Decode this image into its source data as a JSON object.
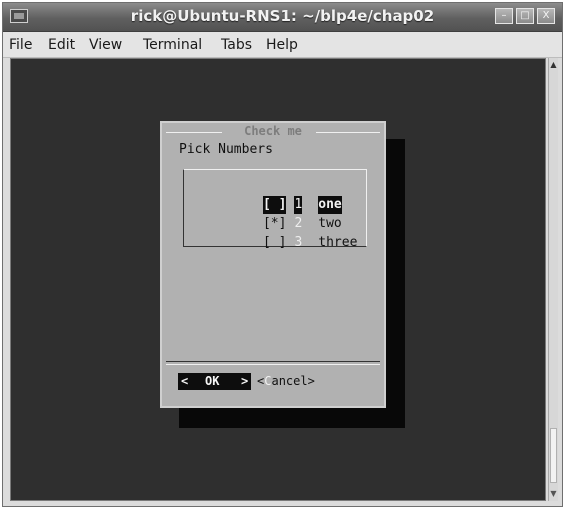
{
  "window": {
    "title": "rick@Ubuntu-RNS1: ~/blp4e/chap02",
    "controls": {
      "minimize": "–",
      "maximize": "□",
      "close": "X"
    }
  },
  "menubar": {
    "items": [
      "File",
      "Edit",
      "View",
      "Terminal",
      "Tabs",
      "Help"
    ]
  },
  "dialog": {
    "title": "Check me",
    "prompt": "Pick Numbers",
    "items": [
      {
        "mark": "[ ]",
        "number": "1",
        "label": "one",
        "checked": false,
        "highlighted": true
      },
      {
        "mark": "[*]",
        "number": "2",
        "label": "two",
        "checked": true,
        "highlighted": false
      },
      {
        "mark": "[ ]",
        "number": "3",
        "label": "three",
        "checked": false,
        "highlighted": false
      }
    ],
    "buttons": {
      "ok": {
        "left": "<",
        "label": "OK",
        "right": ">"
      },
      "cancel": {
        "open": "<",
        "hotkey": "C",
        "rest": "ancel",
        "close": ">"
      }
    }
  },
  "scrollbar": {
    "up_icon": "up-arrow",
    "down_icon": "down-arrow"
  }
}
